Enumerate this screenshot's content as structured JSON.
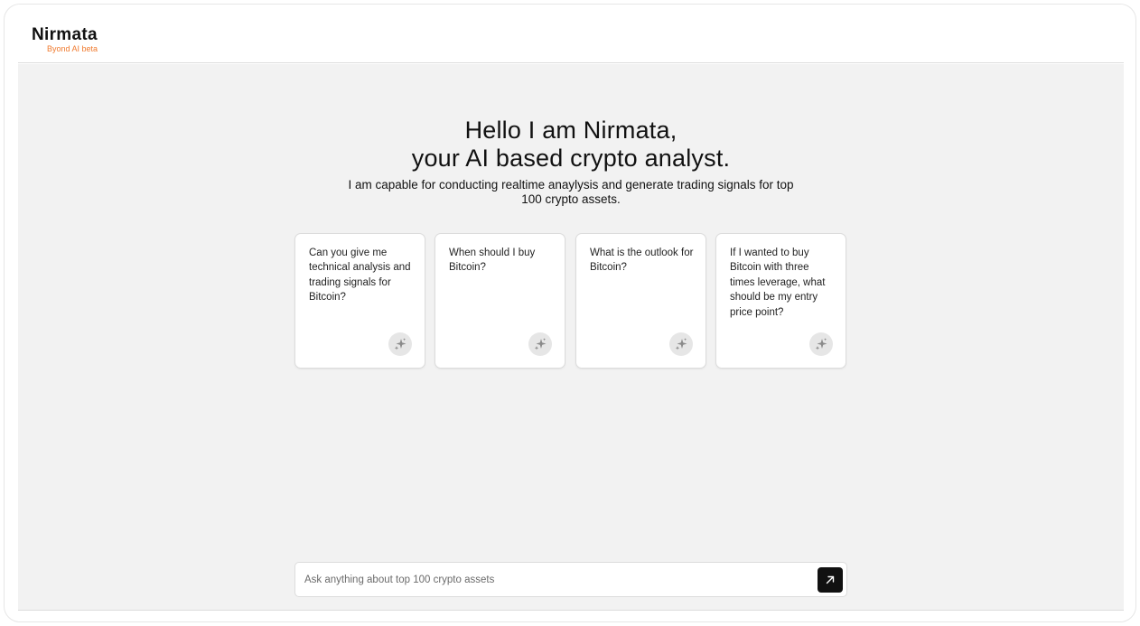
{
  "header": {
    "logo_name": "Nirmata",
    "logo_tag": "Byond AI beta"
  },
  "hero": {
    "title_line1": "Hello I am Nirmata,",
    "title_line2": "your AI based crypto analyst.",
    "subtitle": "I am capable for conducting realtime anaylysis and generate trading signals for top 100 crypto assets."
  },
  "suggestions": [
    {
      "text": "Can you give me technical analysis and trading signals for Bitcoin?",
      "icon": "sparkle-icon"
    },
    {
      "text": "When should I buy Bitcoin?",
      "icon": "sparkle-icon"
    },
    {
      "text": "What is the outlook for Bitcoin?",
      "icon": "sparkle-icon"
    },
    {
      "text": "If I wanted to buy Bitcoin with three times leverage, what should be my entry price point?",
      "icon": "sparkle-icon"
    }
  ],
  "chat_input": {
    "value": "",
    "placeholder": "Ask anything about top 100 crypto assets",
    "send_icon": "arrow-up-right-icon"
  },
  "colors": {
    "accent": "#f07a2e",
    "background": "#f2f2f2",
    "send_button": "#111111"
  }
}
